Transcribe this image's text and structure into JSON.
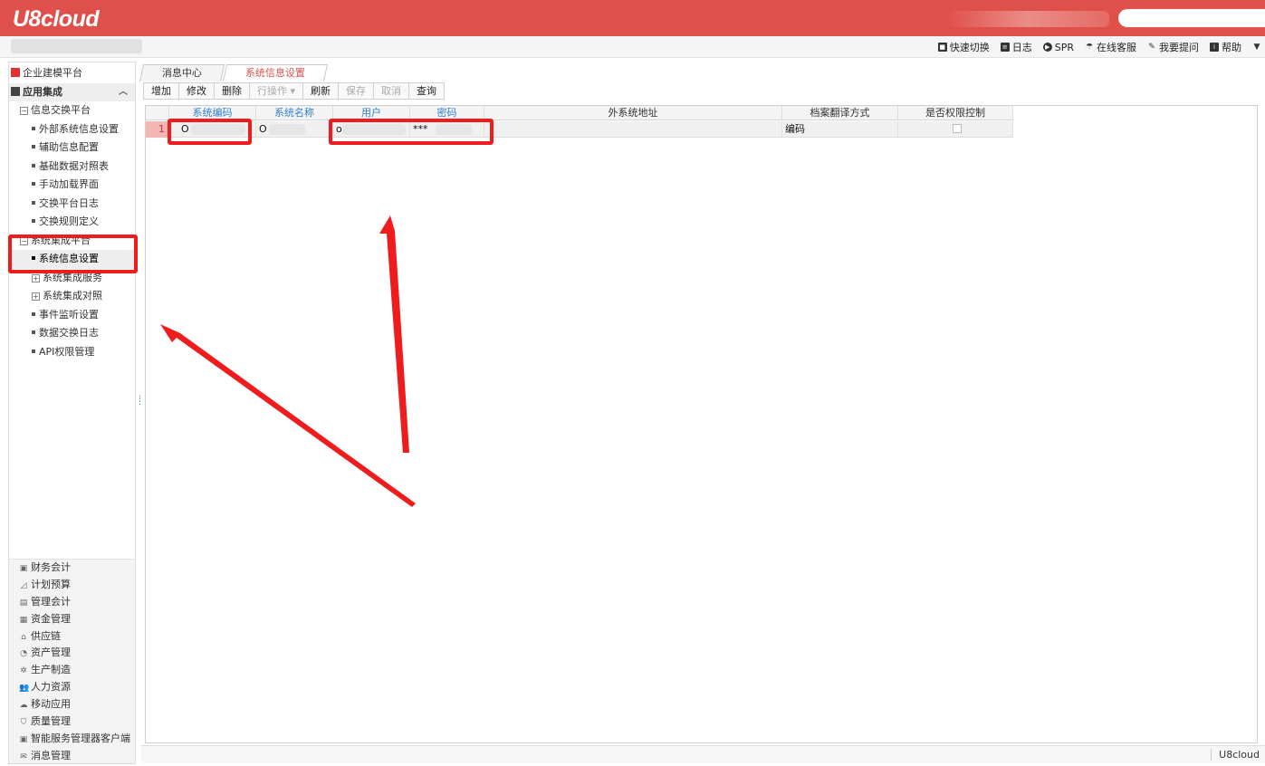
{
  "app": {
    "logo": "U8cloud"
  },
  "header": {
    "links": [
      {
        "label": "快速切换",
        "icon": "switch-icon"
      },
      {
        "label": "日志",
        "icon": "log-icon"
      },
      {
        "label": "SPR",
        "icon": "play-icon"
      },
      {
        "label": "在线客服",
        "icon": "service-icon"
      },
      {
        "label": "我要提问",
        "icon": "question-icon"
      },
      {
        "label": "帮助",
        "icon": "help-icon"
      }
    ]
  },
  "sidebar": {
    "top_items": {
      "enterprise": "企业建模平台",
      "app_integration": "应用集成",
      "info_exchange": "信息交换平台",
      "external_system": "外部系统信息设置",
      "aux_info": "辅助信息配置",
      "base_mapping": "基础数据对照表",
      "manual_load": "手动加载界面",
      "exchange_log": "交换平台日志",
      "exchange_rule": "交换规则定义",
      "system_integration_platform": "系统集成平台",
      "system_info_settings": "系统信息设置",
      "system_integration_service": "系统集成服务",
      "system_integration_mapping": "系统集成对照",
      "event_listener": "事件监听设置",
      "data_exchange_log": "数据交换日志",
      "api_permission": "API权限管理"
    },
    "bottom_items": [
      {
        "label": "财务会计",
        "icon": "briefcase-icon",
        "glyph": "▣"
      },
      {
        "label": "计划预算",
        "icon": "chart-icon",
        "glyph": "◿"
      },
      {
        "label": "管理会计",
        "icon": "calculator-icon",
        "glyph": "▤"
      },
      {
        "label": "资金管理",
        "icon": "money-icon",
        "glyph": "▦"
      },
      {
        "label": "供应链",
        "icon": "supply-icon",
        "glyph": "⌂"
      },
      {
        "label": "资产管理",
        "icon": "asset-icon",
        "glyph": "◔"
      },
      {
        "label": "生产制造",
        "icon": "gear-icon",
        "glyph": "✲"
      },
      {
        "label": "人力资源",
        "icon": "people-icon",
        "glyph": "👥"
      },
      {
        "label": "移动应用",
        "icon": "mobile-icon",
        "glyph": "☁"
      },
      {
        "label": "质量管理",
        "icon": "shield-icon",
        "glyph": "⛉"
      },
      {
        "label": "智能服务管理器客户端",
        "icon": "monitor-icon",
        "glyph": "▣"
      },
      {
        "label": "消息管理",
        "icon": "mail-icon",
        "glyph": "✉"
      }
    ]
  },
  "tabs": [
    {
      "label": "消息中心",
      "active": false
    },
    {
      "label": "系统信息设置",
      "active": true
    }
  ],
  "toolbar": {
    "buttons": [
      {
        "label": "增加",
        "disabled": false
      },
      {
        "label": "修改",
        "disabled": false
      },
      {
        "label": "删除",
        "disabled": false
      },
      {
        "label": "行操作 ▾",
        "disabled": true
      },
      {
        "label": "刷新",
        "disabled": false
      },
      {
        "label": "保存",
        "disabled": true
      },
      {
        "label": "取消",
        "disabled": true
      },
      {
        "label": "查询",
        "disabled": false
      }
    ]
  },
  "grid": {
    "columns": [
      "系统编码",
      "系统名称",
      "用户",
      "密码",
      "外系统地址",
      "档案翻译方式",
      "是否权限控制"
    ],
    "rows": [
      {
        "num": "1",
        "code": "O",
        "name": "O",
        "user": "o",
        "password": "***",
        "address": "",
        "translate": "编码",
        "permission": false
      }
    ]
  },
  "status": {
    "brand": "U8cloud"
  },
  "colors": {
    "header": "#e0504a",
    "highlight": "#ee1c1c",
    "link": "#2f7fd0"
  }
}
